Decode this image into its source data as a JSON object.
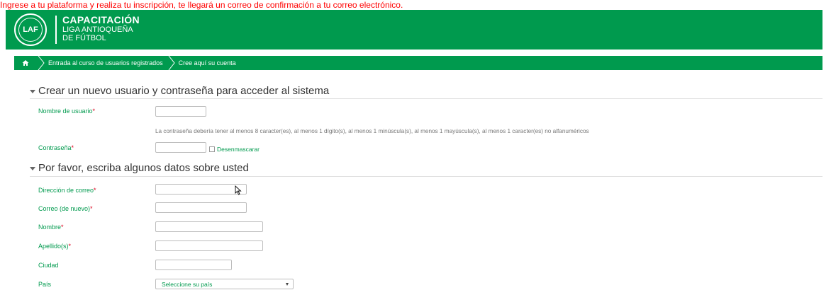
{
  "top_note": "Ingrese a tu plataforma y realiza tu inscripción, te llegará un correo de confirmación a tu correo electrónico.",
  "header": {
    "logo_text": "LAF",
    "title": "CAPACITACIÓN",
    "subtitle_line1": "LIGA ANTIOQUEÑA",
    "subtitle_line2": "DE FÚTBOL"
  },
  "breadcrumb": {
    "items": [
      "Entrada al curso de usuarios registrados",
      "Cree aquí su cuenta"
    ]
  },
  "section1": {
    "title": "Crear un nuevo usuario y contraseña para acceder al sistema",
    "username_label": "Nombre de usuario",
    "password_hint": "La contraseña debería tener al menos 8 caracter(es), al menos 1 dígito(s), al menos 1 minúscula(s), al menos 1 mayúscula(s), al menos 1 caracter(es) no alfanuméricos",
    "password_label": "Contraseña",
    "unmask_label": "Desenmascarar"
  },
  "section2": {
    "title": "Por favor, escriba algunos datos sobre usted",
    "email_label": "Dirección de correo",
    "email_again_label": "Correo (de nuevo)",
    "firstname_label": "Nombre",
    "lastname_label": "Apellido(s)",
    "city_label": "Ciudad",
    "country_label": "País",
    "country_select": "Seleccione su país"
  },
  "required_mark": "*",
  "colors": {
    "brand_green": "#009a4e",
    "required_red": "#d9001b"
  }
}
